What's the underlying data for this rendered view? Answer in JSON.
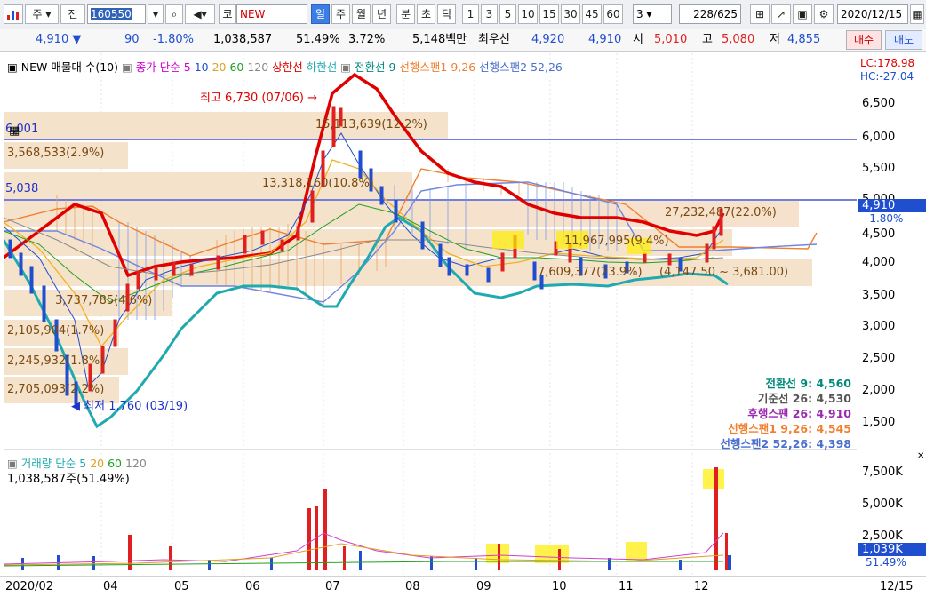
{
  "toolbar1": {
    "cat": "주",
    "market": "전",
    "code": "160550",
    "ko": "코",
    "name": "NEW",
    "periods": [
      "일",
      "주",
      "월",
      "년",
      "분",
      "초",
      "틱"
    ],
    "selected_period": "일",
    "nums": [
      "1",
      "3",
      "5",
      "10",
      "15",
      "30",
      "45",
      "60"
    ],
    "sel_num": "3",
    "count": "228",
    "total": "/625",
    "date": "2020/12/15"
  },
  "quote": {
    "price": "4,910",
    "arrow": "▼",
    "change": "90",
    "rate": "-1.80%",
    "volume": "1,038,587",
    "vol_ratio": "51.49%",
    "turnover": "3.72%",
    "amount": "5,148백만",
    "best_label": "최우선",
    "ask": "4,920",
    "bid": "4,910",
    "open_label": "시",
    "open": "5,010",
    "high_label": "고",
    "high": "5,080",
    "low_label": "저",
    "low": "4,855",
    "buy": "매수",
    "sell": "매도"
  },
  "legend": {
    "main": "NEW 매물대 수(10)",
    "close": "종가 단순 5",
    "ma10": "10",
    "ma20": "20",
    "ma60": "60",
    "ma120": "120",
    "upper": "상한선",
    "lower": "하한선",
    "conv": "전환선 9",
    "span1": "선행스팬1 9,26",
    "span2": "선행스팬2 52,26"
  },
  "price_labels": {
    "lc": "LC:178.98",
    "hc": "HC:-27.04",
    "high_note": "최고 6,730 (07/06)",
    "low_note": "최저 1,760 (03/19)",
    "line1": "6,001",
    "line2": "5,038",
    "current": "4,910",
    "current_rate": "-1.80%",
    "vp": [
      "15,113,639(12.2%)",
      "3,568,533(2.9%)",
      "13,318,160(10.8%)",
      "27,232,487(22.0%)",
      "11,967,995(9.4%)",
      "7,609,377(23.9%)",
      "3,737,785(4.6%)",
      "2,105,904(1.7%)",
      "2,245,932(1.8%)",
      "2,705,093(2.2%)"
    ],
    "range_note": "4,147.50 ~ 3,681.00"
  },
  "ichimoku": [
    {
      "label": "전환선 9",
      "value": "4,560",
      "color": "#00897b"
    },
    {
      "label": "기준선 26",
      "value": "4,530",
      "color": "#555555"
    },
    {
      "label": "후행스팬 26",
      "value": "4,910",
      "color": "#9c27b0"
    },
    {
      "label": "선행스팬1 9,26",
      "value": "4,545",
      "color": "#f08030"
    },
    {
      "label": "선행스팬2 52,26",
      "value": "4,398",
      "color": "#4a6fd0"
    }
  ],
  "volume_legend": {
    "title": "거래량 단순 5",
    "v20": "20",
    "v60": "60",
    "v120": "120",
    "value": "1,038,587주(51.49%)",
    "current": "1,039K",
    "current_rate": "51.49%"
  },
  "price_axis": [
    "6,500",
    "6,000",
    "5,500",
    "5,000",
    "4,500",
    "4,000",
    "3,500",
    "3,000",
    "2,500",
    "2,000",
    "1,500"
  ],
  "vol_axis": [
    "7,500K",
    "5,000K",
    "2,500K"
  ],
  "x_axis": [
    "2020/02",
    "04",
    "05",
    "06",
    "07",
    "08",
    "09",
    "10",
    "11",
    "12",
    "12/15"
  ],
  "colors": {
    "up": "#e02020",
    "down": "#1f4fcf",
    "accent": "#3d7ee6"
  }
}
